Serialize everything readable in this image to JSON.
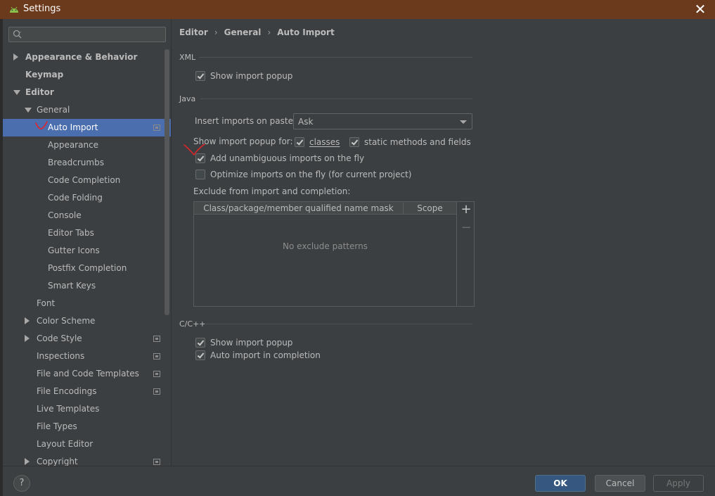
{
  "window": {
    "title": "Settings",
    "close_glyph": "✕"
  },
  "sidebar": {
    "search": {
      "value": "",
      "placeholder": ""
    },
    "items": [
      {
        "label": "Appearance & Behavior",
        "indent": 0,
        "bold": true,
        "expander": "right",
        "icon": ""
      },
      {
        "label": "Keymap",
        "indent": 0,
        "bold": true,
        "expander": "",
        "icon": ""
      },
      {
        "label": "Editor",
        "indent": 0,
        "bold": true,
        "expander": "down",
        "icon": ""
      },
      {
        "label": "General",
        "indent": 1,
        "bold": false,
        "expander": "down",
        "icon": ""
      },
      {
        "label": "Auto Import",
        "indent": 2,
        "bold": false,
        "expander": "",
        "icon": "project-scope-icon",
        "selected": true
      },
      {
        "label": "Appearance",
        "indent": 2,
        "bold": false,
        "expander": "",
        "icon": ""
      },
      {
        "label": "Breadcrumbs",
        "indent": 2,
        "bold": false,
        "expander": "",
        "icon": ""
      },
      {
        "label": "Code Completion",
        "indent": 2,
        "bold": false,
        "expander": "",
        "icon": ""
      },
      {
        "label": "Code Folding",
        "indent": 2,
        "bold": false,
        "expander": "",
        "icon": ""
      },
      {
        "label": "Console",
        "indent": 2,
        "bold": false,
        "expander": "",
        "icon": ""
      },
      {
        "label": "Editor Tabs",
        "indent": 2,
        "bold": false,
        "expander": "",
        "icon": ""
      },
      {
        "label": "Gutter Icons",
        "indent": 2,
        "bold": false,
        "expander": "",
        "icon": ""
      },
      {
        "label": "Postfix Completion",
        "indent": 2,
        "bold": false,
        "expander": "",
        "icon": ""
      },
      {
        "label": "Smart Keys",
        "indent": 2,
        "bold": false,
        "expander": "",
        "icon": ""
      },
      {
        "label": "Font",
        "indent": 1,
        "bold": false,
        "expander": "",
        "icon": ""
      },
      {
        "label": "Color Scheme",
        "indent": 1,
        "bold": false,
        "expander": "right",
        "icon": ""
      },
      {
        "label": "Code Style",
        "indent": 1,
        "bold": false,
        "expander": "right",
        "icon": "project-scope-icon"
      },
      {
        "label": "Inspections",
        "indent": 1,
        "bold": false,
        "expander": "",
        "icon": "project-scope-icon"
      },
      {
        "label": "File and Code Templates",
        "indent": 1,
        "bold": false,
        "expander": "",
        "icon": "project-scope-icon"
      },
      {
        "label": "File Encodings",
        "indent": 1,
        "bold": false,
        "expander": "",
        "icon": "project-scope-icon"
      },
      {
        "label": "Live Templates",
        "indent": 1,
        "bold": false,
        "expander": "",
        "icon": ""
      },
      {
        "label": "File Types",
        "indent": 1,
        "bold": false,
        "expander": "",
        "icon": ""
      },
      {
        "label": "Layout Editor",
        "indent": 1,
        "bold": false,
        "expander": "",
        "icon": ""
      },
      {
        "label": "Copyright",
        "indent": 1,
        "bold": false,
        "expander": "right",
        "icon": "project-scope-icon"
      }
    ]
  },
  "main": {
    "breadcrumb": [
      "Editor",
      "General",
      "Auto Import"
    ],
    "breadcrumb_sep": "›",
    "xml": {
      "title": "XML",
      "show_import_popup": {
        "label": "Show import popup",
        "checked": true
      }
    },
    "java": {
      "title": "Java",
      "insert_imports_label": "Insert imports on paste:",
      "insert_imports_value": "Ask",
      "popup_for_label": "Show import popup for:",
      "classes": {
        "label": "classes",
        "checked": true
      },
      "static_methods": {
        "label": "static methods and fields",
        "checked": true
      },
      "add_unambiguous": {
        "label": "Add unambiguous imports on the fly",
        "checked": true
      },
      "optimize_imports": {
        "label": "Optimize imports on the fly (for current project)",
        "checked": false
      },
      "exclude_label": "Exclude from import and completion:",
      "table": {
        "columns": [
          "Class/package/member qualified name mask",
          "Scope"
        ],
        "empty_text": "No exclude patterns",
        "add_glyph": "+",
        "remove_glyph": "−"
      }
    },
    "cpp": {
      "title": "C/C++",
      "show_import_popup": {
        "label": "Show import popup",
        "checked": true
      },
      "auto_import_completion": {
        "label": "Auto import in completion",
        "checked": true
      }
    }
  },
  "footer": {
    "help": "?",
    "ok": "OK",
    "cancel": "Cancel",
    "apply": "Apply"
  },
  "colors": {
    "titlebar": "#6b3a1d",
    "background": "#3c3f41",
    "selection": "#4b6eaf",
    "ok_button": "#365880",
    "annotation": "#e0252b"
  }
}
